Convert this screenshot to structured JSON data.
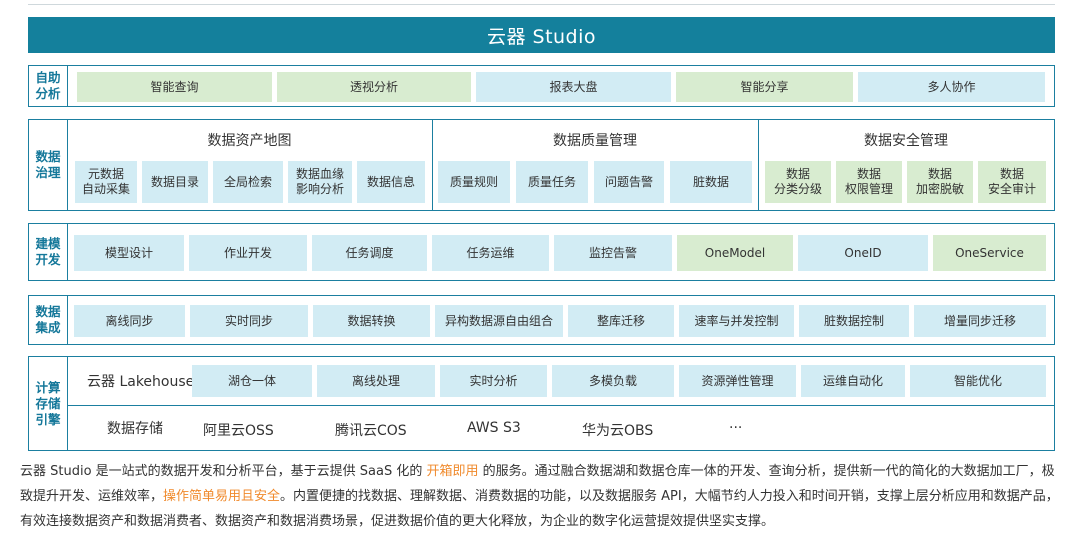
{
  "banner": "云器 Studio",
  "rows": {
    "self_analysis": {
      "label": "自助\n分析",
      "items": [
        {
          "label": "智能查询",
          "color": "green"
        },
        {
          "label": "透视分析",
          "color": "green"
        },
        {
          "label": "报表大盘",
          "color": "blue"
        },
        {
          "label": "智能分享",
          "color": "green"
        },
        {
          "label": "多人协作",
          "color": "blue"
        }
      ]
    },
    "governance": {
      "label": "数据\n治理",
      "groups": [
        {
          "title": "数据资产地图",
          "items": [
            "元数据\n自动采集",
            "数据目录",
            "全局检索",
            "数据血缘\n影响分析",
            "数据信息"
          ]
        },
        {
          "title": "数据质量管理",
          "items": [
            "质量规则",
            "质量任务",
            "问题告警",
            "脏数据"
          ]
        },
        {
          "title": "数据安全管理",
          "items": [
            "数据\n分类分级",
            "数据\n权限管理",
            "数据\n加密脱敏",
            "数据\n安全审计"
          ]
        }
      ]
    },
    "modeling": {
      "label": "建模\n开发",
      "items": [
        {
          "label": "模型设计",
          "color": "blue"
        },
        {
          "label": "作业开发",
          "color": "blue"
        },
        {
          "label": "任务调度",
          "color": "blue"
        },
        {
          "label": "任务运维",
          "color": "blue"
        },
        {
          "label": "监控告警",
          "color": "blue"
        },
        {
          "label": "OneModel",
          "color": "green"
        },
        {
          "label": "OneID",
          "color": "blue"
        },
        {
          "label": "OneService",
          "color": "green"
        }
      ]
    },
    "integration": {
      "label": "数据\n集成",
      "items": [
        "离线同步",
        "实时同步",
        "数据转换",
        "异构数据源自由组合",
        "整库迁移",
        "速率与并发控制",
        "脏数据控制",
        "增量同步迁移"
      ]
    },
    "compute": {
      "label": "计算\n存储\n引擎",
      "lakehouse_title": "云器 Lakehouse",
      "lakehouse_items": [
        "湖仓一体",
        "离线处理",
        "实时分析",
        "多模负载",
        "资源弹性管理",
        "运维自动化",
        "智能优化"
      ],
      "storage_title": "数据存储",
      "storage_items": [
        "阿里云OSS",
        "腾讯云COS",
        "AWS S3",
        "华为云OBS",
        "···"
      ]
    }
  },
  "description": {
    "p1": "云器 Studio 是一站式的数据开发和分析平台，基于云提供 SaaS 化的 ",
    "h1": "开箱即用",
    "p2": " 的服务。通过融合数据湖和数据仓库一体的开发、查询分析，提供新一代的简化的大数据加工厂，极致提升开发、运维效率，",
    "h2": "操作简单易用且安全",
    "p3": "。内置便捷的找数据、理解数据、消费数据的功能，以及数据服务 API，大幅节约人力投入和时间开销，支撑上层分析应用和数据产品，有效连接数据资产和数据消费者、数据资产和数据消费场景，促进数据价值的更大化释放，为企业的数字化运营提效提供坚实支撑。"
  },
  "colors": {
    "banner": "#14809c",
    "border": "#1b7fa0",
    "green": "#d8ecd0",
    "blue": "#d2ecf4",
    "highlight": "#f08a2c"
  }
}
